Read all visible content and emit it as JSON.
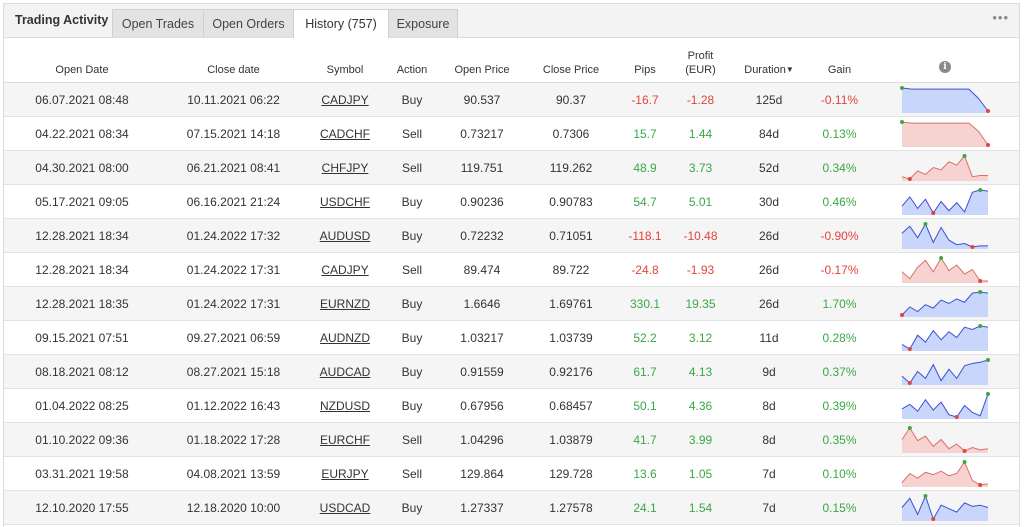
{
  "title": "Trading Activity",
  "tabs": [
    {
      "label": "Open Trades"
    },
    {
      "label": "Open Orders"
    },
    {
      "label": "History (757)"
    },
    {
      "label": "Exposure"
    }
  ],
  "more_icon": "•••",
  "columns": {
    "open_date": "Open Date",
    "close_date": "Close date",
    "symbol": "Symbol",
    "action": "Action",
    "open_price": "Open Price",
    "close_price": "Close Price",
    "pips": "Pips",
    "profit_line1": "Profit",
    "profit_line2": "(EUR)",
    "duration": "Duration",
    "gain": "Gain",
    "chart_info_icon": "i"
  },
  "colors": {
    "positive": "#3aa845",
    "negative": "#e2443c",
    "buy_fill": "#c9d6fb",
    "sell_fill": "#f6d2d0"
  },
  "rows": [
    {
      "open_date": "06.07.2021 08:48",
      "close_date": "10.11.2021 06:22",
      "symbol": "CADJPY",
      "action": "Buy",
      "open_price": "90.537",
      "close_price": "90.37",
      "pips": "-16.7",
      "profit": "-1.28",
      "duration": "125d",
      "gain": "-0.11%",
      "sign": "neg",
      "spark": [
        1.0,
        0.95,
        0.95,
        0.95,
        0.95,
        0.95,
        0.95,
        0.95,
        0.55,
        0.0
      ],
      "spark_style": "buy"
    },
    {
      "open_date": "04.22.2021 08:34",
      "close_date": "07.15.2021 14:18",
      "symbol": "CADCHF",
      "action": "Sell",
      "open_price": "0.73217",
      "close_price": "0.7306",
      "pips": "15.7",
      "profit": "1.44",
      "duration": "84d",
      "gain": "0.13%",
      "sign": "pos",
      "spark": [
        1.0,
        0.95,
        0.95,
        0.95,
        0.95,
        0.95,
        0.95,
        0.95,
        0.6,
        0.0
      ],
      "spark_style": "sell"
    },
    {
      "open_date": "04.30.2021 08:00",
      "close_date": "06.21.2021 08:41",
      "symbol": "CHFJPY",
      "action": "Sell",
      "open_price": "119.751",
      "close_price": "119.262",
      "pips": "48.9",
      "profit": "3.73",
      "duration": "52d",
      "gain": "0.34%",
      "sign": "pos",
      "spark": [
        0.1,
        0.0,
        0.35,
        0.2,
        0.5,
        0.4,
        0.75,
        0.6,
        1.0,
        0.1,
        0.15,
        0.15
      ],
      "spark_style": "sell"
    },
    {
      "open_date": "05.17.2021 09:05",
      "close_date": "06.16.2021 21:24",
      "symbol": "USDCHF",
      "action": "Buy",
      "open_price": "0.90236",
      "close_price": "0.90783",
      "pips": "54.7",
      "profit": "5.01",
      "duration": "30d",
      "gain": "0.46%",
      "sign": "pos",
      "spark": [
        0.3,
        0.7,
        0.2,
        0.6,
        0.0,
        0.5,
        0.1,
        0.45,
        0.05,
        0.9,
        1.0,
        0.95
      ],
      "spark_style": "buy"
    },
    {
      "open_date": "12.28.2021 18:34",
      "close_date": "01.24.2022 17:32",
      "symbol": "AUDUSD",
      "action": "Buy",
      "open_price": "0.72232",
      "close_price": "0.71051",
      "pips": "-118.1",
      "profit": "-10.48",
      "duration": "26d",
      "gain": "-0.90%",
      "sign": "neg",
      "spark": [
        0.6,
        0.9,
        0.4,
        1.0,
        0.2,
        0.85,
        0.3,
        0.1,
        0.15,
        0.0,
        0.05,
        0.05
      ],
      "spark_style": "buy"
    },
    {
      "open_date": "12.28.2021 18:34",
      "close_date": "01.24.2022 17:31",
      "symbol": "CADJPY",
      "action": "Sell",
      "open_price": "89.474",
      "close_price": "89.722",
      "pips": "-24.8",
      "profit": "-1.93",
      "duration": "26d",
      "gain": "-0.17%",
      "sign": "neg",
      "spark": [
        0.4,
        0.1,
        0.6,
        0.9,
        0.4,
        1.0,
        0.45,
        0.7,
        0.3,
        0.5,
        0.0,
        0.0
      ],
      "spark_style": "sell"
    },
    {
      "open_date": "12.28.2021 18:35",
      "close_date": "01.24.2022 17:31",
      "symbol": "EURNZD",
      "action": "Buy",
      "open_price": "1.6646",
      "close_price": "1.69761",
      "pips": "330.1",
      "profit": "19.35",
      "duration": "26d",
      "gain": "1.70%",
      "sign": "pos",
      "spark": [
        0.0,
        0.35,
        0.15,
        0.45,
        0.3,
        0.65,
        0.5,
        0.7,
        0.55,
        0.95,
        1.0,
        0.95
      ],
      "spark_style": "buy"
    },
    {
      "open_date": "09.15.2021 07:51",
      "close_date": "09.27.2021 06:59",
      "symbol": "AUDNZD",
      "action": "Buy",
      "open_price": "1.03217",
      "close_price": "1.03739",
      "pips": "52.2",
      "profit": "3.12",
      "duration": "11d",
      "gain": "0.28%",
      "sign": "pos",
      "spark": [
        0.2,
        0.0,
        0.6,
        0.3,
        0.8,
        0.4,
        0.75,
        0.5,
        0.95,
        0.85,
        1.0,
        0.95
      ],
      "spark_style": "buy"
    },
    {
      "open_date": "08.18.2021 08:12",
      "close_date": "08.27.2021 15:18",
      "symbol": "AUDCAD",
      "action": "Buy",
      "open_price": "0.91559",
      "close_price": "0.92176",
      "pips": "61.7",
      "profit": "4.13",
      "duration": "9d",
      "gain": "0.37%",
      "sign": "pos",
      "spark": [
        0.3,
        0.0,
        0.5,
        0.2,
        0.8,
        0.1,
        0.6,
        0.2,
        0.75,
        0.85,
        0.9,
        1.0
      ],
      "spark_style": "buy"
    },
    {
      "open_date": "01.04.2022 08:25",
      "close_date": "01.12.2022 16:43",
      "symbol": "NZDUSD",
      "action": "Buy",
      "open_price": "0.67956",
      "close_price": "0.68457",
      "pips": "50.1",
      "profit": "4.36",
      "duration": "8d",
      "gain": "0.39%",
      "sign": "pos",
      "spark": [
        0.35,
        0.55,
        0.25,
        0.75,
        0.3,
        0.65,
        0.1,
        0.0,
        0.5,
        0.2,
        0.05,
        1.0
      ],
      "spark_style": "buy"
    },
    {
      "open_date": "01.10.2022 09:36",
      "close_date": "01.18.2022 17:28",
      "symbol": "EURCHF",
      "action": "Sell",
      "open_price": "1.04296",
      "close_price": "1.03879",
      "pips": "41.7",
      "profit": "3.99",
      "duration": "8d",
      "gain": "0.35%",
      "sign": "pos",
      "spark": [
        0.5,
        1.0,
        0.45,
        0.65,
        0.2,
        0.5,
        0.1,
        0.3,
        0.0,
        0.15,
        0.05,
        0.1
      ],
      "spark_style": "sell"
    },
    {
      "open_date": "03.31.2021 19:58",
      "close_date": "04.08.2021 13:59",
      "symbol": "EURJPY",
      "action": "Sell",
      "open_price": "129.864",
      "close_price": "129.728",
      "pips": "13.6",
      "profit": "1.05",
      "duration": "7d",
      "gain": "0.10%",
      "sign": "pos",
      "spark": [
        0.1,
        0.5,
        0.3,
        0.55,
        0.45,
        0.6,
        0.4,
        0.5,
        1.0,
        0.2,
        0.0,
        0.05
      ],
      "spark_style": "sell"
    },
    {
      "open_date": "12.10.2020 17:55",
      "close_date": "12.18.2020 10:00",
      "symbol": "USDCAD",
      "action": "Buy",
      "open_price": "1.27337",
      "close_price": "1.27578",
      "pips": "24.1",
      "profit": "1.54",
      "duration": "7d",
      "gain": "0.15%",
      "sign": "pos",
      "spark": [
        0.5,
        0.9,
        0.2,
        1.0,
        0.0,
        0.6,
        0.45,
        0.3,
        0.7,
        0.55,
        0.6,
        0.5
      ],
      "spark_style": "buy"
    }
  ]
}
